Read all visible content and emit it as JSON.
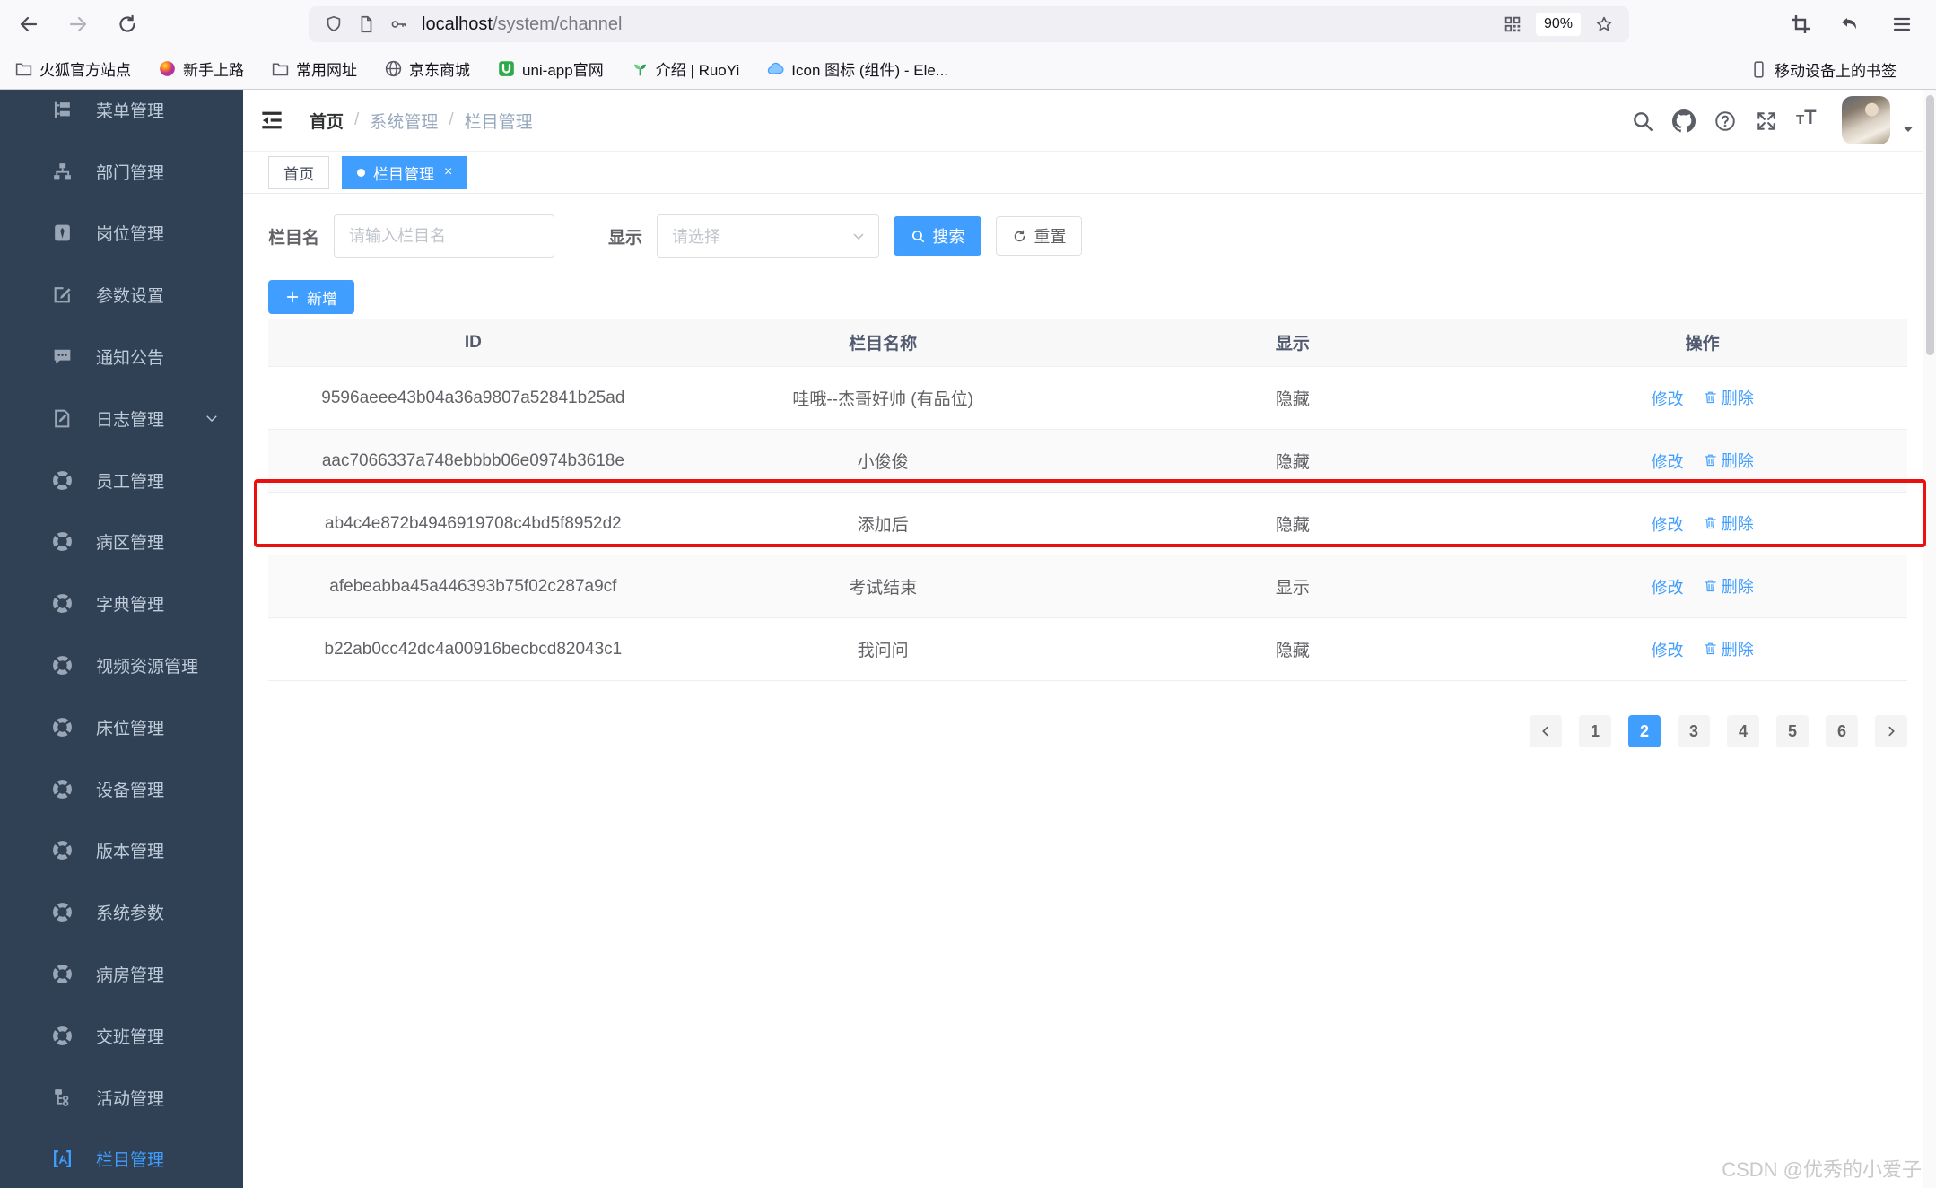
{
  "browser": {
    "url_host": "localhost",
    "url_path": "/system/channel",
    "zoom_level": "90%",
    "bookmarks": [
      {
        "icon": "folder",
        "label": "火狐官方站点"
      },
      {
        "icon": "firefox",
        "label": "新手上路"
      },
      {
        "icon": "folder",
        "label": "常用网址"
      },
      {
        "icon": "globe",
        "label": "京东商城"
      },
      {
        "icon": "uniapp",
        "label": "uni-app官网"
      },
      {
        "icon": "seedling",
        "label": "介绍 | RuoYi"
      },
      {
        "icon": "cloud",
        "label": "Icon 图标 (组件) - Ele..."
      }
    ],
    "mobile_bookmarks_label": "移动设备上的书签"
  },
  "header": {
    "breadcrumb": [
      "首页",
      "系统管理",
      "栏目管理"
    ],
    "breadcrumb_separator": "/"
  },
  "tabs": [
    {
      "label": "首页",
      "active": false,
      "closable": false
    },
    {
      "label": "栏目管理",
      "active": true,
      "closable": true
    }
  ],
  "sidebar": {
    "items": [
      {
        "label": "菜单管理",
        "icon": "menu-tree",
        "active": false,
        "has_arrow": false
      },
      {
        "label": "部门管理",
        "icon": "org-tree",
        "active": false,
        "has_arrow": false
      },
      {
        "label": "岗位管理",
        "icon": "post",
        "active": false,
        "has_arrow": false
      },
      {
        "label": "参数设置",
        "icon": "edit-square",
        "active": false,
        "has_arrow": false
      },
      {
        "label": "通知公告",
        "icon": "message",
        "active": false,
        "has_arrow": false
      },
      {
        "label": "日志管理",
        "icon": "log",
        "active": false,
        "has_arrow": true
      },
      {
        "label": "员工管理",
        "icon": "component",
        "active": false,
        "has_arrow": false
      },
      {
        "label": "病区管理",
        "icon": "component",
        "active": false,
        "has_arrow": false
      },
      {
        "label": "字典管理",
        "icon": "component",
        "active": false,
        "has_arrow": false
      },
      {
        "label": "视频资源管理",
        "icon": "component",
        "active": false,
        "has_arrow": false
      },
      {
        "label": "床位管理",
        "icon": "component",
        "active": false,
        "has_arrow": false
      },
      {
        "label": "设备管理",
        "icon": "component",
        "active": false,
        "has_arrow": false
      },
      {
        "label": "版本管理",
        "icon": "component",
        "active": false,
        "has_arrow": false
      },
      {
        "label": "系统参数",
        "icon": "component",
        "active": false,
        "has_arrow": false
      },
      {
        "label": "病房管理",
        "icon": "component",
        "active": false,
        "has_arrow": false
      },
      {
        "label": "交班管理",
        "icon": "component",
        "active": false,
        "has_arrow": false
      },
      {
        "label": "活动管理",
        "icon": "activity-tree",
        "active": false,
        "has_arrow": false
      },
      {
        "label": "栏目管理",
        "icon": "channel",
        "active": true,
        "has_arrow": false
      }
    ]
  },
  "filters": {
    "name_label": "栏目名",
    "name_placeholder": "请输入栏目名",
    "display_label": "显示",
    "display_placeholder": "请选择",
    "search_label": "搜索",
    "reset_label": "重置",
    "add_label": "新增"
  },
  "table": {
    "headers": [
      "ID",
      "栏目名称",
      "显示",
      "操作"
    ],
    "edit_label": "修改",
    "delete_label": "删除",
    "highlight_row_index": 2,
    "rows": [
      {
        "id": "9596aeee43b04a36a9807a52841b25ad",
        "name": "哇哦--杰哥好帅 (有品位)",
        "display": "隐藏"
      },
      {
        "id": "aac7066337a748ebbbb06e0974b3618e",
        "name": "小俊俊",
        "display": "隐藏"
      },
      {
        "id": "ab4c4e872b4946919708c4bd5f8952d2",
        "name": "添加后",
        "display": "隐藏"
      },
      {
        "id": "afebeabba45a446393b75f02c287a9cf",
        "name": "考试结束",
        "display": "显示"
      },
      {
        "id": "b22ab0cc42dc4a00916becbcd82043c1",
        "name": "我问问",
        "display": "隐藏"
      }
    ]
  },
  "pagination": {
    "pages": [
      "1",
      "2",
      "3",
      "4",
      "5",
      "6"
    ],
    "active_page": "2"
  },
  "watermark": "CSDN @优秀的小爱子",
  "colors": {
    "primary": "#409eff",
    "sidebar_bg": "#304156",
    "annotation": "#ec0f0f"
  }
}
